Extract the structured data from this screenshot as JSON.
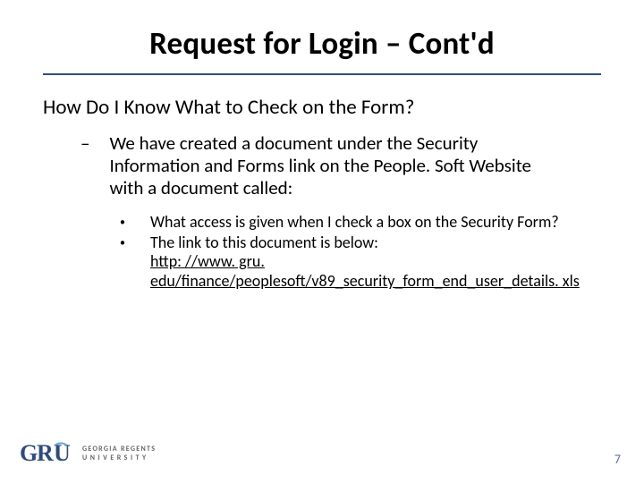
{
  "title": "Request for Login – Cont'd",
  "subheading": "How Do I Know What to Check on the Form?",
  "dash": "–",
  "dash_text": "We have created a document under the Security Information and Forms link on the People. Soft Website with a document called:",
  "bullets": [
    "What access is given when I check a box on the Security Form?",
    "The link to this document is below:"
  ],
  "link_text": "http: //www. gru. edu/finance/peoplesoft/v89_security_form_end_user_details. xls",
  "logo": {
    "line1": "GEORGIA REGENTS",
    "line2": "UNIVERSITY"
  },
  "page_number": "7",
  "dot": "•"
}
